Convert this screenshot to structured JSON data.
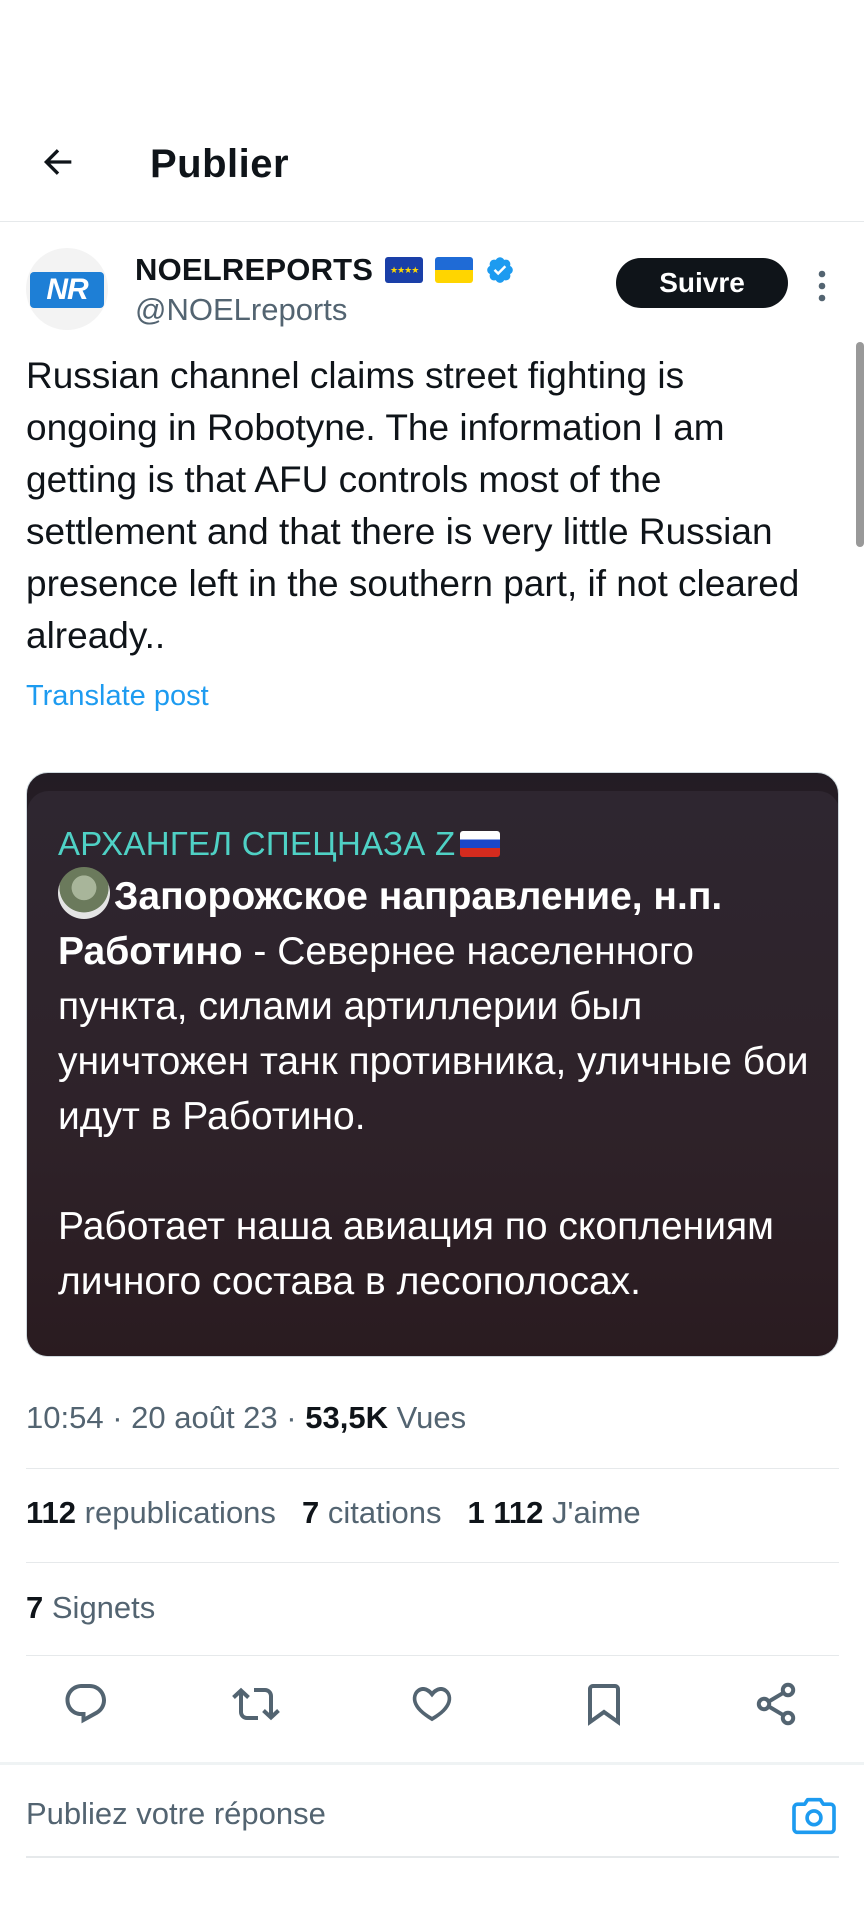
{
  "header": {
    "title": "Publier"
  },
  "author": {
    "display_name": "NOELREPORTS",
    "handle": "@NOELreports",
    "avatar_text": "NR",
    "follow_label": "Suivre"
  },
  "post": {
    "text": "Russian channel claims street fighting is ongoing in Robotyne. The information I am getting is that AFU controls most of the settlement and that there is very little Russian presence left in the southern part, if not cleared already..",
    "translate_label": "Translate post"
  },
  "media": {
    "channel_name": "АРХАНГЕЛ СПЕЦНАЗА Z",
    "bold_heading": "Запорожское направление, н.п. Работино",
    "body_part1": " - Севернее населенного пункта, силами артиллерии был уничтожен танк противника, уличные бои идут в Работино.",
    "body_part2": "Работает наша авиация по скоплениям личного состава в лесополосах."
  },
  "meta": {
    "time": "10:54",
    "date": "20 août 23",
    "views_count": "53,5K",
    "views_label": "Vues"
  },
  "stats": {
    "reposts_count": "112",
    "reposts_label": "republications",
    "quotes_count": "7",
    "quotes_label": "citations",
    "likes_count": "1 112",
    "likes_label": "J'aime",
    "bookmarks_count": "7",
    "bookmarks_label": "Signets"
  },
  "reply": {
    "placeholder": "Publiez votre réponse"
  },
  "icons": {
    "back": "arrow-left-icon",
    "more": "more-vertical-icon",
    "reply": "reply-icon",
    "repost": "repost-icon",
    "like": "heart-icon",
    "bookmark": "bookmark-icon",
    "share": "share-icon",
    "camera": "camera-icon",
    "verified": "verified-badge-icon"
  },
  "colors": {
    "accent": "#1d9bf0",
    "text": "#0f1419",
    "secondary": "#536471",
    "channel_name": "#4fd1c5"
  }
}
